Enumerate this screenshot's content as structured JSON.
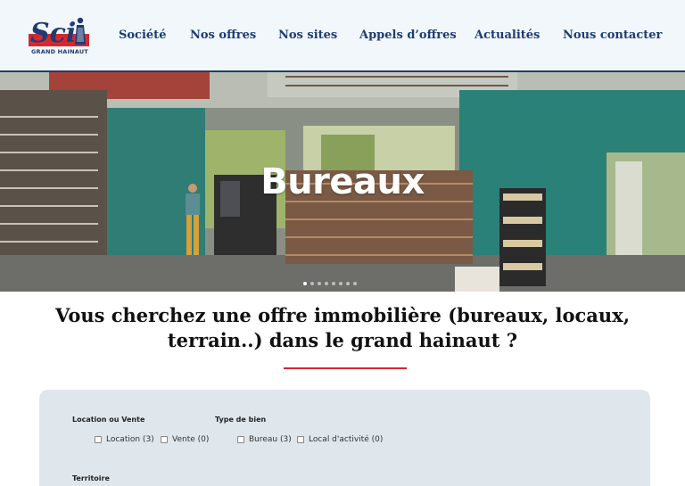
{
  "brand": {
    "logo_text": "Sci",
    "logo_subtitle": "GRAND HAINAUT",
    "colors": {
      "navy": "#1e3c73",
      "red": "#d6282f"
    }
  },
  "nav": {
    "items": [
      {
        "label": "Société"
      },
      {
        "label": "Nos offres"
      },
      {
        "label": "Nos sites"
      },
      {
        "label": "Appels d’offres"
      },
      {
        "label": "Actualités"
      },
      {
        "label": "Nous contacter"
      }
    ]
  },
  "hero": {
    "title": "Bureaux",
    "slides_count": 8,
    "active_slide": 1
  },
  "headline": {
    "line1": "Vous cherchez une offre immobilière (bureaux, locaux,",
    "line2": "terrain..) dans le grand hainaut ?"
  },
  "search": {
    "group1": {
      "label": "Location ou Vente",
      "options": [
        {
          "label": "Location (3)",
          "checked": false
        },
        {
          "label": "Vente (0)",
          "checked": false
        }
      ]
    },
    "group2": {
      "label": "Type de bien",
      "options": [
        {
          "label": "Bureau (3)",
          "checked": false
        },
        {
          "label": "Local d'activité (0)",
          "checked": false
        }
      ]
    },
    "group3": {
      "label": "Territoire"
    }
  }
}
